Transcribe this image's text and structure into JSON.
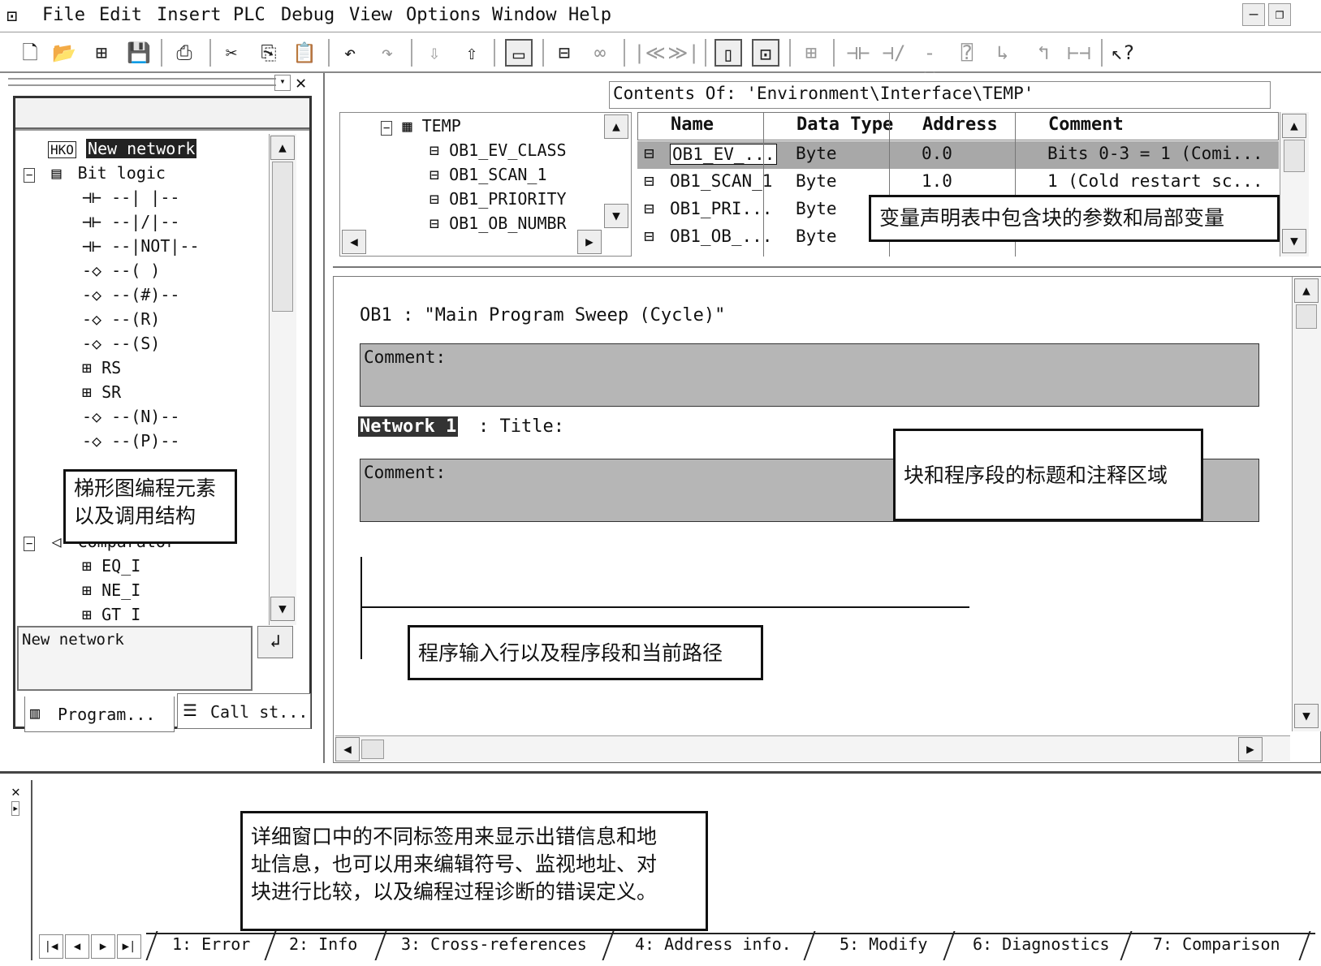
{
  "menu": {
    "items": [
      "File",
      "Edit",
      "Insert",
      "PLC",
      "Debug",
      "View",
      "Options",
      "Window",
      "Help"
    ]
  },
  "toolbar": {
    "icons": [
      "new-icon",
      "open-icon",
      "accessible-nodes-icon",
      "save-icon",
      "print-icon",
      "cut-icon",
      "copy-icon",
      "paste-icon",
      "undo-icon",
      "redo-icon",
      "download-icon",
      "upload-icon",
      "overview-icon",
      "monitor-icon",
      "previous-icon",
      "next-icon",
      "panel-toggle-icon",
      "details-toggle-icon",
      "new-network-icon",
      "contact-no-icon",
      "contact-nc-icon",
      "coil-icon",
      "empty-box-icon",
      "branch-open-icon",
      "branch-close-icon",
      "connection-icon",
      "help-icon"
    ],
    "prev_label": "|≪",
    "next_label": "≫|"
  },
  "left_panel": {
    "tree": [
      {
        "label": "New network",
        "selected": true
      },
      {
        "label": "Bit logic",
        "group": true
      },
      {
        "label": "--|   |--"
      },
      {
        "label": "--|/|--"
      },
      {
        "label": "--|NOT|--"
      },
      {
        "label": "--( )"
      },
      {
        "label": "--(#)--"
      },
      {
        "label": "--(R)"
      },
      {
        "label": "--(S)"
      },
      {
        "label": "RS"
      },
      {
        "label": "SR"
      },
      {
        "label": "--(N)--"
      },
      {
        "label": "--(P)--"
      },
      {
        "label": "Comparator",
        "group": true
      },
      {
        "label": "EQ_I"
      },
      {
        "label": "NE_I"
      },
      {
        "label": "GT_I"
      }
    ],
    "info_text": "New network",
    "tabs": [
      "Program...",
      "Call st..."
    ]
  },
  "var_decl": {
    "contents_label": "Contents Of: 'Environment\\Interface\\TEMP'",
    "tree": [
      "TEMP",
      "OB1_EV_CLASS",
      "OB1_SCAN_1",
      "OB1_PRIORITY",
      "OB1_OB_NUMBR"
    ],
    "columns": [
      "Name",
      "Data Type",
      "Address",
      "Comment"
    ],
    "rows": [
      {
        "name": "OB1_EV_...",
        "type": "Byte",
        "address": "0.0",
        "comment": "Bits 0-3 = 1 (Comi..."
      },
      {
        "name": "OB1_SCAN_1",
        "type": "Byte",
        "address": "1.0",
        "comment": "1 (Cold restart sc..."
      },
      {
        "name": "OB1_PRI...",
        "type": "Byte",
        "address": "",
        "comment": ""
      },
      {
        "name": "OB1_OB_...",
        "type": "Byte",
        "address": "",
        "comment": ""
      }
    ]
  },
  "code": {
    "block_title": "OB1 :  \"Main Program Sweep (Cycle)\"",
    "comment_label": "Comment:",
    "network_label": "Network 1",
    "network_title": ": Title:",
    "network_comment_label": "Comment:"
  },
  "details": {
    "tabs": [
      "1: Error",
      "2: Info",
      "3: Cross-references",
      "4: Address info.",
      "5: Modify",
      "6: Diagnostics",
      "7: Comparison"
    ]
  },
  "callouts": {
    "var_decl": "变量声明表中包含块的参数和局部变量",
    "ladder": [
      "梯形图编程元素",
      "以及调用结构"
    ],
    "title_comment": "块和程序段的标题和注释区域",
    "input_line": "程序输入行以及程序段和当前路径",
    "details": [
      "详细窗口中的不同标签用来显示出错信息和地",
      "址信息，也可以用来编辑符号、监视地址、对",
      "块进行比较，以及编程过程诊断的错误定义。"
    ]
  }
}
